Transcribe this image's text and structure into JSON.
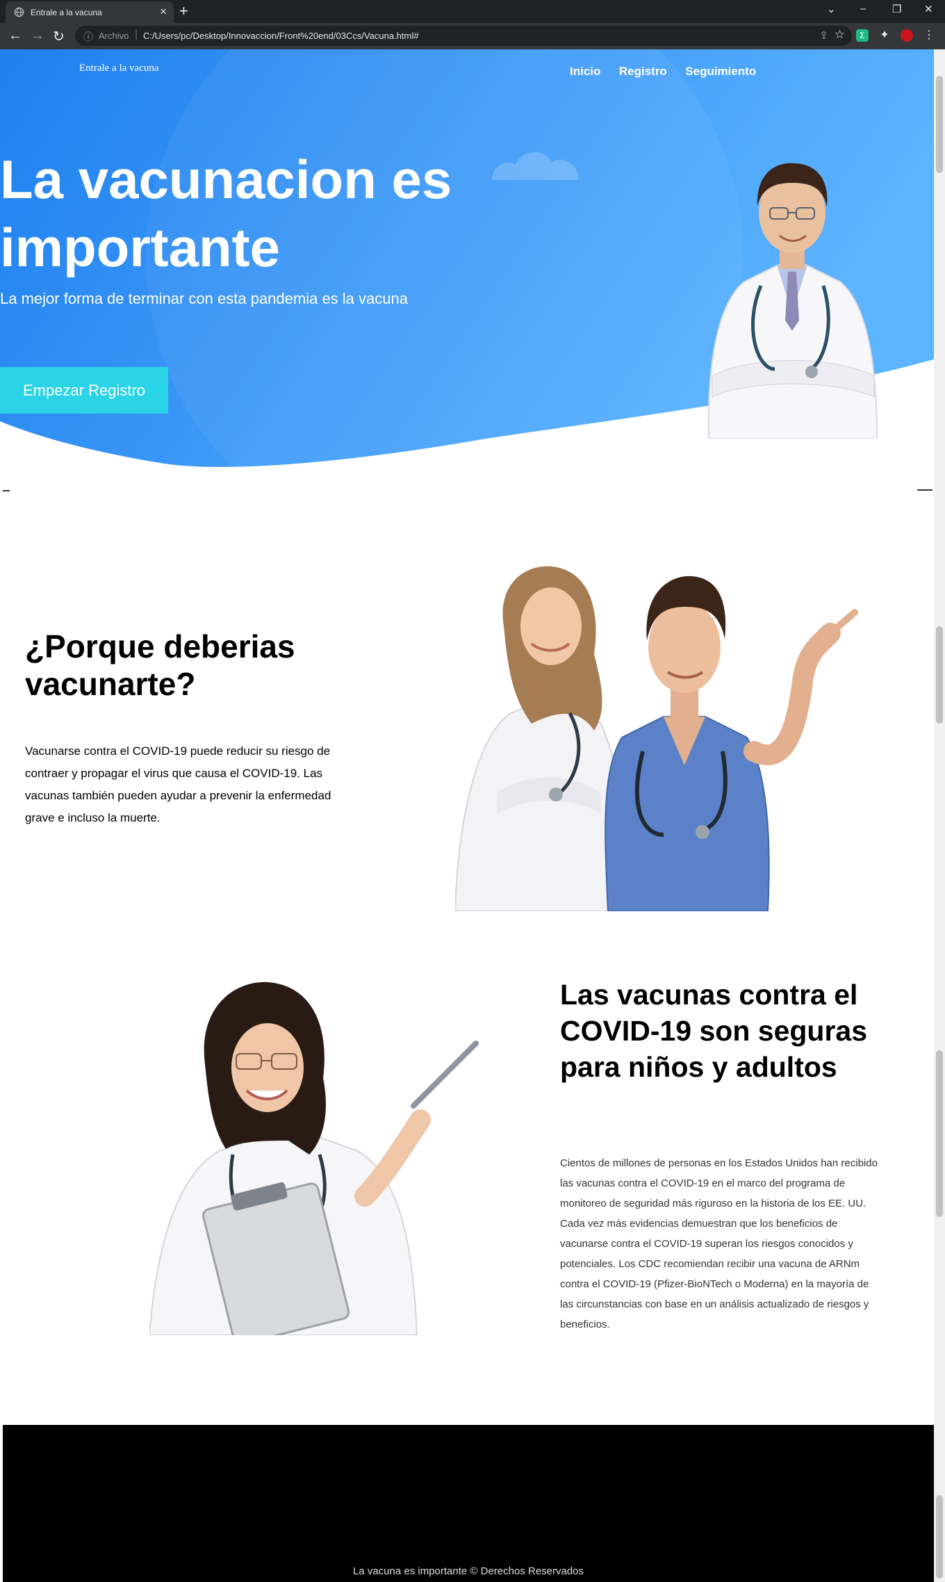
{
  "browser": {
    "tab_title": "Entrale a la vacuna",
    "scheme_label": "Archivo",
    "url": "C:/Users/pc/Desktop/Innovaccion/Front%20end/03Ccs/Vacuna.html#"
  },
  "header": {
    "brand": "Entrale a la vacuna",
    "nav": [
      "Inicio",
      "Registro",
      "Seguimiento"
    ]
  },
  "hero": {
    "title": "La vacunacion es importante",
    "subtitle": "La mejor forma de terminar con esta pandemia es la vacuna",
    "cta_label": "Empezar Registro"
  },
  "section_why": {
    "title": "¿Porque deberias vacunarte?",
    "body": "Vacunarse contra el COVID-19 puede reducir su riesgo de contraer y propagar el virus que causa el COVID-19. Las vacunas también pueden ayudar a prevenir la enfermedad grave e incluso la muerte."
  },
  "section_safe": {
    "title": "Las vacunas contra el COVID-19 son seguras para niños y adultos",
    "body": "Cientos de millones de personas en los Estados Unidos han recibido las vacunas contra el COVID-19 en el marco del programa de monitoreo de seguridad más riguroso en la historia de los EE. UU. Cada vez más evidencias demuestran que los beneficios de vacunarse contra el COVID-19 superan los riesgos conocidos y potenciales. Los CDC recomiendan recibir una vacuna de ARNm contra el COVID-19 (Pfizer-BioNTech o Moderna) en la mayoría de las circunstancias con base en un análisis actualizado de riesgos y beneficios."
  },
  "footer": {
    "text": "La vacuna es importante © Derechos Reservados"
  },
  "colors": {
    "hero_blue_dark": "#1f82f0",
    "hero_blue_light": "#5cb0ff",
    "cta": "#2ad3e6",
    "footer_bg": "#000000"
  },
  "icons": [
    "globe-icon",
    "close-icon",
    "plus-icon",
    "back-icon",
    "forward-icon",
    "reload-icon",
    "info-icon",
    "share-icon",
    "star-icon",
    "extension-icon",
    "profile-icon",
    "menu-icon"
  ]
}
